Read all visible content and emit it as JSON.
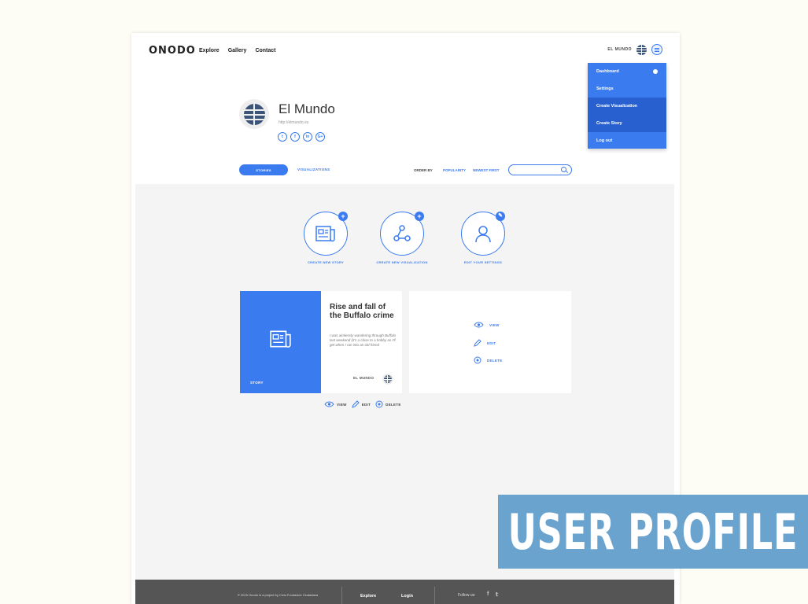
{
  "header": {
    "logo": "ONODO",
    "nav": [
      "Explore",
      "Gallery",
      "Contact"
    ],
    "username": "EL MUNDO"
  },
  "dropdown": {
    "items": [
      "Dashboard",
      "Settings",
      "Create Visualization",
      "Create Story",
      "Log out"
    ]
  },
  "profile": {
    "name": "El Mundo",
    "url": "http://elmundo.es",
    "socials": [
      "twitter",
      "facebook",
      "linkedin",
      "google-plus"
    ],
    "social_glyphs": [
      "t",
      "f",
      "in",
      "G+"
    ]
  },
  "tabs": {
    "active": "STORIES",
    "second": "VISUALIZATIONS",
    "order_by": "ORDER BY",
    "sort_popularity": "POPULARITY",
    "sort_newest": "NEWEST FIRST",
    "search_placeholder": ""
  },
  "actions": [
    {
      "label": "CREATE NEW STORY",
      "icon": "newspaper-icon"
    },
    {
      "label": "CREATE NEW VISUALIZATION",
      "icon": "network-icon"
    },
    {
      "label": "EDIT YOUR SETTINGS",
      "icon": "user-icon"
    }
  ],
  "story_card": {
    "type": "STORY",
    "title": "Rise and fall of the Buffalo crime",
    "excerpt": "I was aimlessly wandering through Buffalo last weekend (it's a close to a hobby as I'll get when I ran into an old friend",
    "source": "EL MUNDO"
  },
  "overlay": {
    "view": "VIEW",
    "edit": "EDIT",
    "delete": "DELETE"
  },
  "card_actions": {
    "view": "VIEW",
    "edit": "EDIT",
    "delete": "DELETE"
  },
  "footer": {
    "copyright": "© 2015 Onodo is a project by Civio Fundación Ciudadana",
    "explore": "Explore",
    "login": "Login",
    "follow": "Follow us:"
  },
  "banner": {
    "text": "USER PROFILE"
  },
  "colors": {
    "accent": "#3a7bf0",
    "banner": "#6ba3cf",
    "footer": "#555555"
  }
}
